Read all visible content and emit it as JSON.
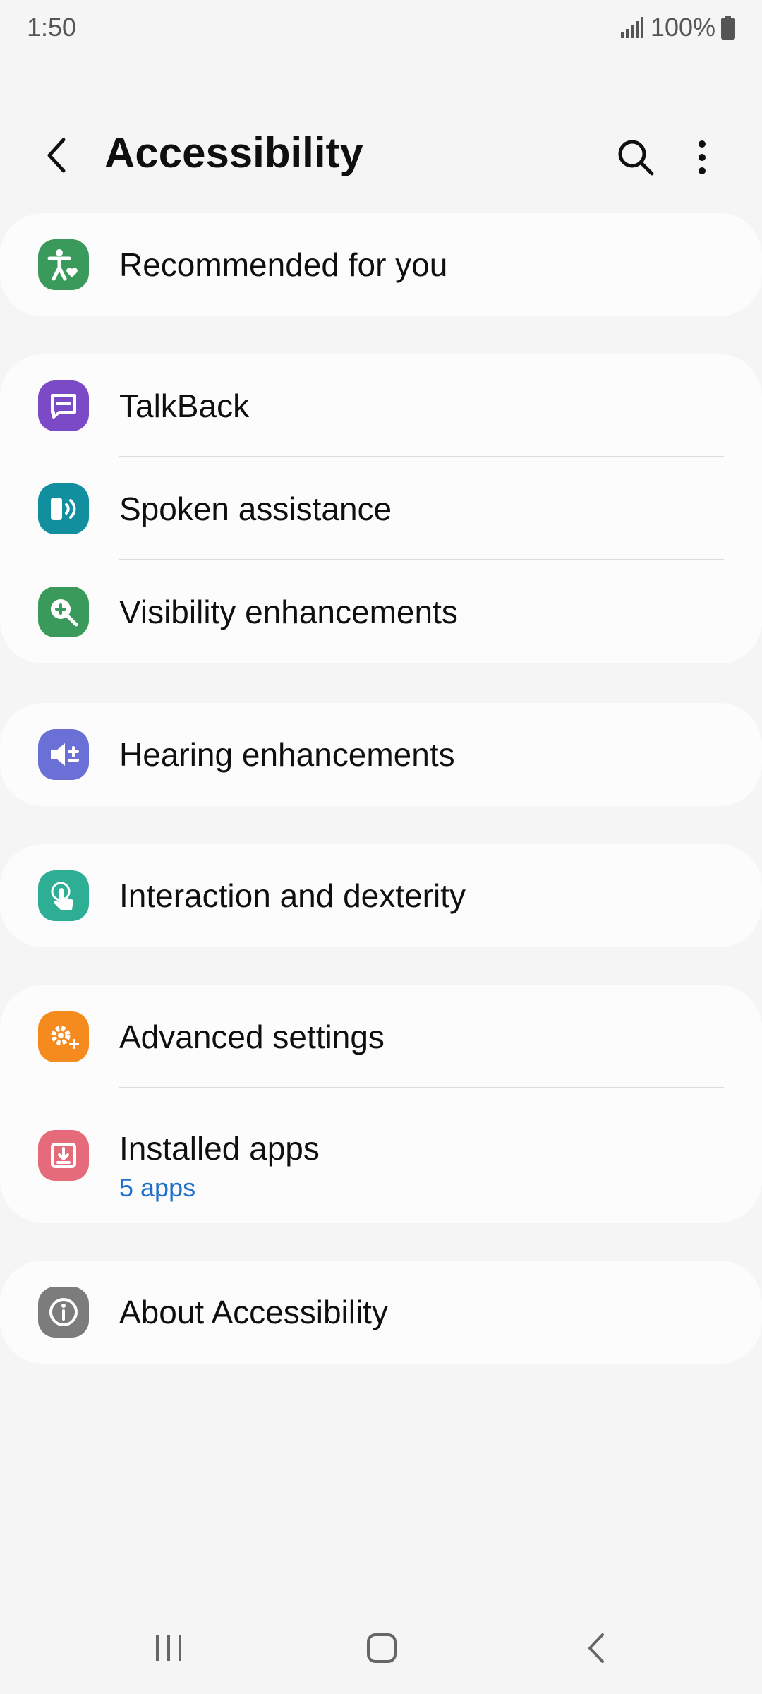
{
  "status_bar": {
    "time": "1:50",
    "battery": "100%"
  },
  "header": {
    "title": "Accessibility"
  },
  "groups": [
    {
      "items": [
        {
          "label": "Recommended for you",
          "icon": "accessibility-heart-icon",
          "color": "#3a9a5c"
        }
      ]
    },
    {
      "items": [
        {
          "label": "TalkBack",
          "icon": "talkback-icon",
          "color": "#7b4bc7"
        },
        {
          "label": "Spoken assistance",
          "icon": "spoken-assistance-icon",
          "color": "#118f9e"
        },
        {
          "label": "Visibility enhancements",
          "icon": "magnifier-plus-icon",
          "color": "#3a9a5c"
        }
      ]
    },
    {
      "items": [
        {
          "label": "Hearing enhancements",
          "icon": "hearing-icon",
          "color": "#6b70d6"
        }
      ]
    },
    {
      "items": [
        {
          "label": "Interaction and dexterity",
          "icon": "touch-hand-icon",
          "color": "#2fae96"
        }
      ]
    },
    {
      "items": [
        {
          "label": "Advanced settings",
          "icon": "gear-plus-icon",
          "color": "#f58a1f"
        },
        {
          "label": "Installed apps",
          "sublabel": "5 apps",
          "icon": "download-icon",
          "color": "#e56b7b"
        }
      ]
    },
    {
      "items": [
        {
          "label": "About Accessibility",
          "icon": "info-icon",
          "color": "#7c7c7c"
        }
      ]
    }
  ]
}
